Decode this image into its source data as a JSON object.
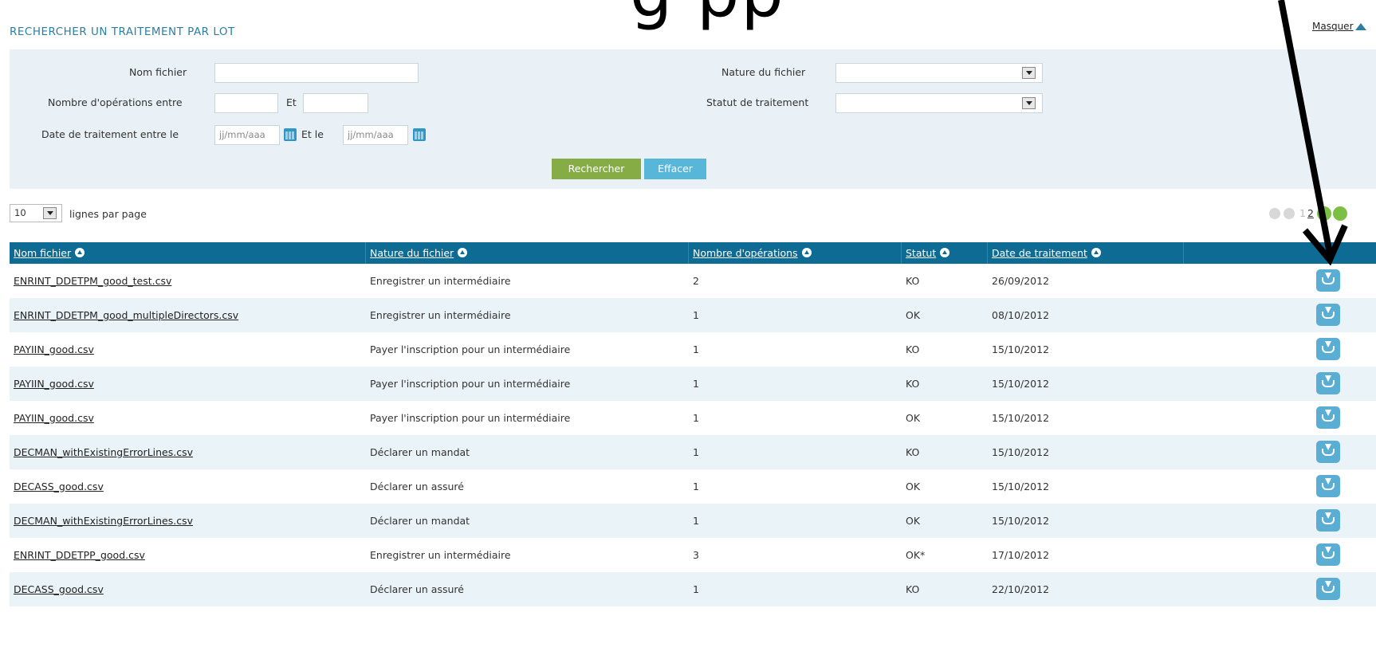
{
  "overlay": {
    "big_text": "g   pp"
  },
  "section_title": "RECHERCHER UN TRAITEMENT PAR LOT",
  "masquer": "Masquer",
  "search": {
    "nom_fichier_label": "Nom fichier",
    "nature_label": "Nature du fichier",
    "nb_ops_label": "Nombre d'opérations entre",
    "et_label": "Et",
    "statut_label": "Statut de traitement",
    "date_label": "Date de traitement entre le",
    "date_from_placeholder": "jj/mm/aaa",
    "et_le_label": "Et le",
    "date_to_placeholder": "jj/mm/aaa",
    "search_button": "Rechercher",
    "clear_button": "Effacer"
  },
  "per_page": {
    "value": "10",
    "label": "lignes par page"
  },
  "pagination": {
    "pages": [
      "1",
      "2"
    ],
    "current": "2"
  },
  "columns": [
    "Nom fichier",
    "Nature du fichier",
    "Nombre d'opérations",
    "Statut",
    "Date de traitement"
  ],
  "rows": [
    {
      "file": "ENRINT_DDETPM_good_test.csv",
      "nature": "Enregistrer un intermédiaire",
      "ops": "2",
      "status": "KO",
      "date": "26/09/2012"
    },
    {
      "file": "ENRINT_DDETPM_good_multipleDirectors.csv",
      "nature": "Enregistrer un intermédiaire",
      "ops": "1",
      "status": "OK",
      "date": "08/10/2012"
    },
    {
      "file": "PAYIIN_good.csv",
      "nature": "Payer l'inscription pour un intermédiaire",
      "ops": "1",
      "status": "KO",
      "date": "15/10/2012"
    },
    {
      "file": "PAYIIN_good.csv",
      "nature": "Payer l'inscription pour un intermédiaire",
      "ops": "1",
      "status": "KO",
      "date": "15/10/2012"
    },
    {
      "file": "PAYIIN_good.csv",
      "nature": "Payer l'inscription pour un intermédiaire",
      "ops": "1",
      "status": "OK",
      "date": "15/10/2012"
    },
    {
      "file": "DECMAN_withExistingErrorLines.csv",
      "nature": "Déclarer un mandat",
      "ops": "1",
      "status": "KO",
      "date": "15/10/2012"
    },
    {
      "file": "DECASS_good.csv",
      "nature": "Déclarer un assuré",
      "ops": "1",
      "status": "OK",
      "date": "15/10/2012"
    },
    {
      "file": "DECMAN_withExistingErrorLines.csv",
      "nature": "Déclarer un mandat",
      "ops": "1",
      "status": "OK",
      "date": "15/10/2012"
    },
    {
      "file": "ENRINT_DDETPP_good.csv",
      "nature": "Enregistrer un intermédiaire",
      "ops": "3",
      "status": "OK*",
      "date": "17/10/2012"
    },
    {
      "file": "DECASS_good.csv",
      "nature": "Déclarer un assuré",
      "ops": "1",
      "status": "KO",
      "date": "22/10/2012"
    }
  ],
  "icons": {
    "download": "download-icon",
    "calendar": "calendar-icon",
    "sort": "sort-icon",
    "arrow": "pointer-arrow"
  }
}
